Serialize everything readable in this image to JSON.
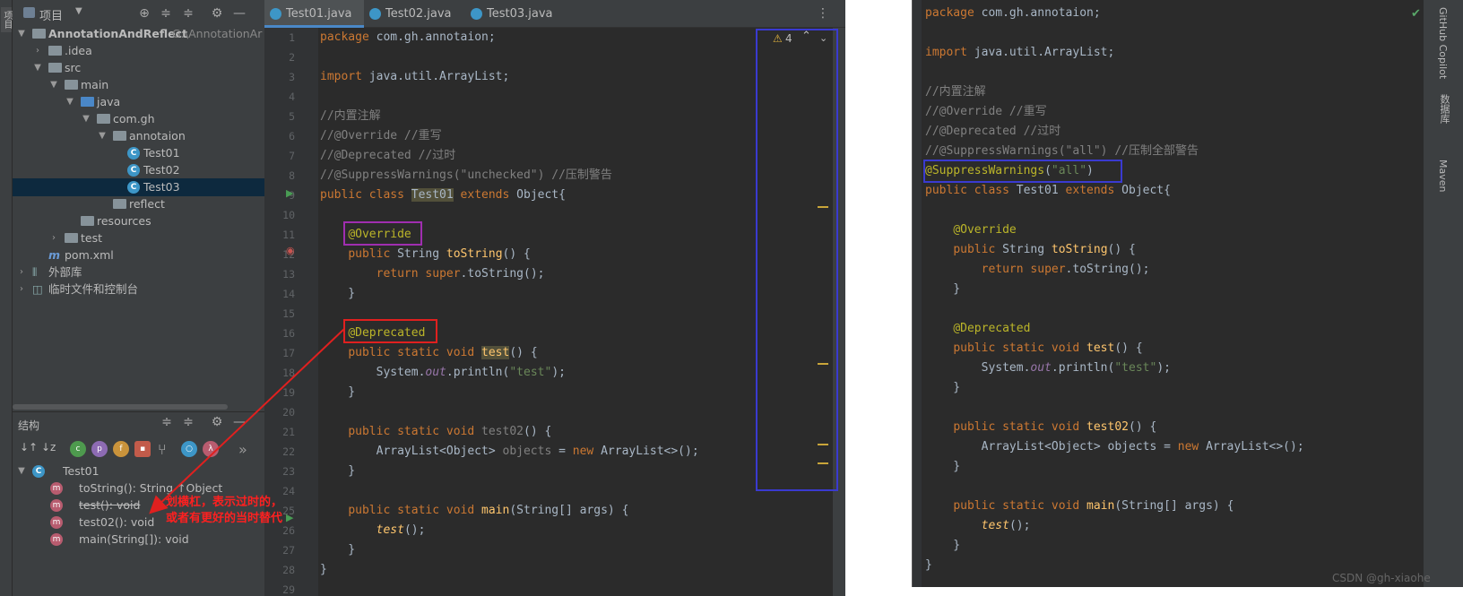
{
  "left": {
    "stripe_label": "项目",
    "project_header": "项目",
    "tree": [
      {
        "label": "AnnotationAndReflect",
        "extra": "G:\\AnnotationAr",
        "type": "module"
      },
      {
        "label": ".idea",
        "type": "folder"
      },
      {
        "label": "src",
        "type": "folder"
      },
      {
        "label": "main",
        "type": "folder"
      },
      {
        "label": "java",
        "type": "folder"
      },
      {
        "label": "com.gh",
        "type": "folder"
      },
      {
        "label": "annotaion",
        "type": "folder"
      },
      {
        "label": "Test01",
        "type": "class"
      },
      {
        "label": "Test02",
        "type": "class"
      },
      {
        "label": "Test03",
        "type": "class"
      },
      {
        "label": "reflect",
        "type": "folder"
      },
      {
        "label": "resources",
        "type": "folder"
      },
      {
        "label": "test",
        "type": "folder"
      },
      {
        "label": "pom.xml",
        "type": "file"
      },
      {
        "label": "外部库",
        "type": "lib"
      },
      {
        "label": "临时文件和控制台",
        "type": "scratch"
      }
    ],
    "tabs": [
      "Test01.java",
      "Test02.java",
      "Test03.java"
    ],
    "warnings": "4",
    "line_numbers": [
      "1",
      "2",
      "3",
      "4",
      "5",
      "6",
      "7",
      "8",
      "9",
      "10",
      "11",
      "12",
      "13",
      "14",
      "15",
      "16",
      "17",
      "18",
      "19",
      "20",
      "21",
      "22",
      "23",
      "24",
      "25",
      "26",
      "27",
      "28",
      "29"
    ],
    "structure": {
      "title": "结构",
      "root": "Test01",
      "items": [
        {
          "label": "toString(): String ↑Object"
        },
        {
          "label": "test(): void"
        },
        {
          "label": "test02(): void"
        },
        {
          "label": "main(String[]): void"
        }
      ]
    },
    "note_line1": "划横杠，表示过时的，",
    "note_line2": "或者有更好的当时替代"
  },
  "right": {
    "side_labels": [
      "GitHub Copilot",
      "数据库",
      "Maven"
    ]
  },
  "watermark": "CSDN @gh-xiaohe",
  "colors": {
    "keyword": "#cc7832",
    "annotation": "#bbb529",
    "comment": "#808080",
    "string": "#6a8759",
    "method": "#ffc66d"
  }
}
